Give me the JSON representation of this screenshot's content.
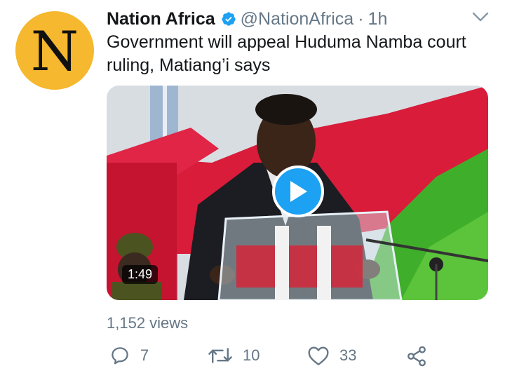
{
  "tweet": {
    "avatar_letter": "N",
    "author_name": "Nation Africa",
    "handle": "@NationAfrica",
    "separator": "·",
    "time": "1h",
    "text": "Government will appeal Huduma Namba court ruling, Matiang’i says"
  },
  "media": {
    "duration": "1:49",
    "views": "1,152 views"
  },
  "actions": {
    "replies": "7",
    "retweets": "10",
    "likes": "33"
  },
  "colors": {
    "accent": "#1da1f2",
    "secondary_text": "#657786",
    "avatar_bg": "#f5b82e"
  },
  "icons": [
    "verified-badge-icon",
    "chevron-down-icon",
    "play-icon",
    "reply-icon",
    "retweet-icon",
    "like-icon",
    "share-icon"
  ]
}
